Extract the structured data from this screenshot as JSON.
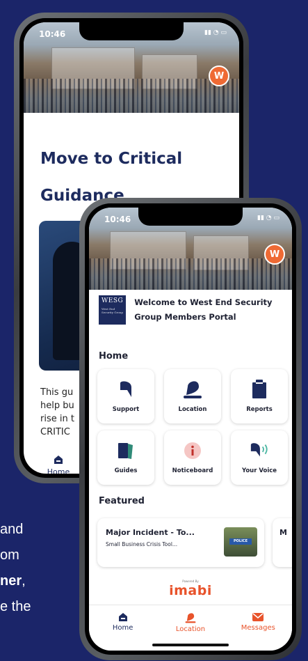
{
  "background_text": {
    "line1": "and",
    "line2": "om",
    "line3_bold": "ner",
    "line3_rest": ",",
    "line4": "e the"
  },
  "back_phone": {
    "status_time": "10:46",
    "avatar_letter": "W",
    "title": "Move to Critical Guidance",
    "body_lines": [
      "This gu",
      "help bu",
      "rise in t",
      "CRITIC"
    ],
    "nav_home": "Home"
  },
  "front_phone": {
    "status_time": "10:46",
    "avatar_letter": "W",
    "logo": {
      "abbr": "WESG",
      "sub": "West End Security Group"
    },
    "welcome": "Welcome to West End Security Group Members Portal",
    "home_heading": "Home",
    "tiles": [
      {
        "label": "Support",
        "icon": "support-icon"
      },
      {
        "label": "Location",
        "icon": "location-icon"
      },
      {
        "label": "Reports",
        "icon": "reports-icon"
      },
      {
        "label": "Guides",
        "icon": "guides-icon"
      },
      {
        "label": "Noticeboard",
        "icon": "noticeboard-icon"
      },
      {
        "label": "Your Voice",
        "icon": "voice-icon"
      }
    ],
    "featured_heading": "Featured",
    "featured": {
      "title": "Major Incident - To...",
      "subtitle": "Small Business Crisis Tool...",
      "thumb_badge": "POLICE",
      "peek": "M"
    },
    "powered_by": "Powered By",
    "brand": "imabi",
    "tabs": [
      {
        "label": "Home",
        "active": true
      },
      {
        "label": "Location",
        "active": false
      },
      {
        "label": "Messages",
        "active": false
      }
    ]
  },
  "colors": {
    "background": "#1b2569",
    "navy": "#1d2b5e",
    "accent": "#e8532b",
    "avatar": "#ef6a34"
  }
}
